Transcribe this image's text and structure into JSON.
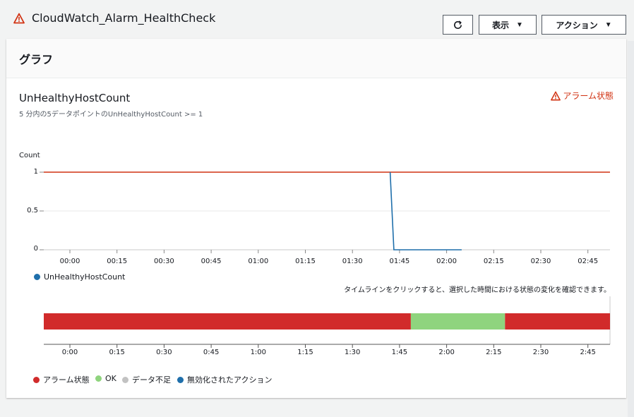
{
  "header": {
    "title": "CloudWatch_Alarm_HealthCheck",
    "refresh_label": "",
    "view_label": "表示",
    "actions_label": "アクション"
  },
  "panel": {
    "title": "グラフ"
  },
  "metric": {
    "name": "UnHealthyHostCount",
    "condition": "5 分内の5データポイントのUnHealthyHostCount >= 1",
    "state": "アラーム状態"
  },
  "colors": {
    "alarm": "#d12b2b",
    "ok": "#8fd47e",
    "insufficient": "#c2c2c2",
    "disabled_action": "#1f6fab",
    "series": "#1f6fab",
    "threshold": "#d13212"
  },
  "chart_data": [
    {
      "type": "line",
      "ylabel": "Count",
      "ylim": [
        0,
        1
      ],
      "yticks": [
        "1",
        "0.5",
        "0"
      ],
      "xticks": [
        "00:00",
        "00:15",
        "00:30",
        "00:45",
        "01:00",
        "01:15",
        "01:30",
        "01:45",
        "02:00",
        "02:15",
        "02:30",
        "02:45"
      ],
      "threshold": 1,
      "series": [
        {
          "name": "UnHealthyHostCount",
          "points": [
            [
              1.7,
              1
            ],
            [
              1.72,
              0
            ],
            [
              2.08,
              0
            ]
          ]
        }
      ],
      "legend_position": "bottom-left"
    },
    {
      "type": "timeline",
      "hint": "タイムラインをクリックすると、選択した時間における状態の変化を確認できます。",
      "xticks": [
        "0:00",
        "0:15",
        "0:30",
        "0:45",
        "1:00",
        "1:15",
        "1:30",
        "1:45",
        "2:00",
        "2:15",
        "2:30",
        "2:45"
      ],
      "segments": [
        {
          "state": "alarm",
          "start": -0.14,
          "end": 1.81
        },
        {
          "state": "ok",
          "start": 1.81,
          "end": 2.31
        },
        {
          "state": "alarm",
          "start": 2.31,
          "end": 2.87
        }
      ],
      "legend": [
        {
          "label": "アラーム状態",
          "color_key": "alarm"
        },
        {
          "label": "OK",
          "color_key": "ok"
        },
        {
          "label": "データ不足",
          "color_key": "insufficient"
        },
        {
          "label": "無効化されたアクション",
          "color_key": "disabled_action"
        }
      ]
    }
  ]
}
